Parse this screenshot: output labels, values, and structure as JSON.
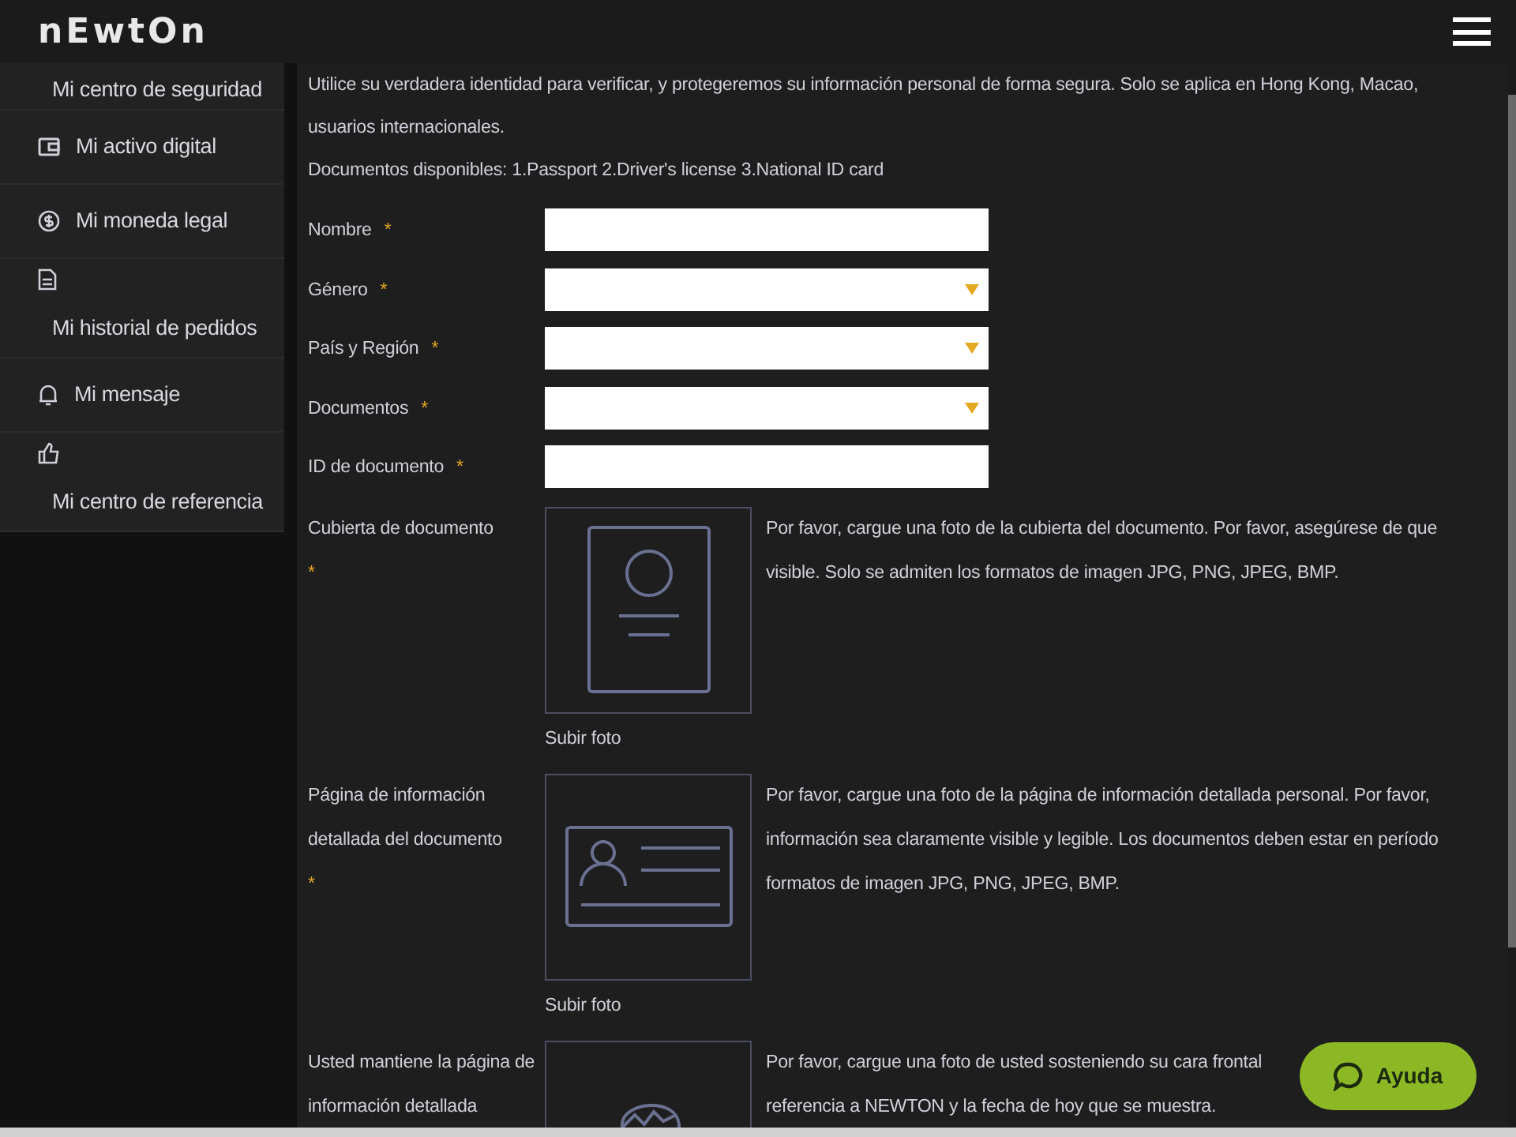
{
  "header": {
    "logo": "nEwtOn"
  },
  "sidebar": {
    "items": [
      {
        "label": "Mi centro de seguridad",
        "kind": "plain"
      },
      {
        "label": "Mi activo digital",
        "kind": "inline"
      },
      {
        "label": "Mi moneda legal",
        "kind": "inline"
      },
      {
        "label": "Mi historial de pedidos",
        "kind": "stacked"
      },
      {
        "label": "Mi mensaje",
        "kind": "inline"
      },
      {
        "label": "Mi centro de referencia",
        "kind": "stacked"
      }
    ]
  },
  "intro": [
    "Utilice su verdadera identidad para verificar, y protegeremos su información personal de forma segura. Solo se aplica en Hong Kong, Macao,",
    "usuarios internacionales.",
    "Documentos disponibles: 1.Passport 2.Driver's license 3.National ID card"
  ],
  "fields": [
    {
      "label": "Nombre",
      "required_mark": "*",
      "kind": "text"
    },
    {
      "label": "Género",
      "required_mark": "*",
      "kind": "select"
    },
    {
      "label": "País y Región",
      "required_mark": "*",
      "kind": "select"
    },
    {
      "label": "Documentos",
      "required_mark": "*",
      "kind": "select"
    },
    {
      "label": "ID de documento",
      "required_mark": "*",
      "kind": "text"
    }
  ],
  "uploads": [
    {
      "label": "Cubierta de documento",
      "required_mark": "*",
      "kind": "cover",
      "button": "Subir foto",
      "description": [
        "Por favor, cargue una foto de la cubierta del documento. Por favor, asegúrese de que",
        "visible. Solo se admiten los formatos de imagen JPG, PNG, JPEG, BMP."
      ]
    },
    {
      "label": "Página de información detallada del documento",
      "required_mark": "*",
      "kind": "info",
      "button": "Subir foto",
      "description": [
        "Por favor, cargue una foto de la página de información detallada personal. Por favor,",
        "información sea claramente visible y legible. Los documentos deben estar en período",
        "formatos de imagen JPG, PNG, JPEG, BMP."
      ]
    },
    {
      "label": "Usted mantiene la página de información detallada",
      "kind": "selfie",
      "description": [
        "Por favor, cargue una foto de usted sosteniendo su cara frontal",
        "referencia a NEWTON y la fecha de hoy que se muestra."
      ]
    }
  ],
  "help_button": {
    "label": "Ayuda"
  }
}
